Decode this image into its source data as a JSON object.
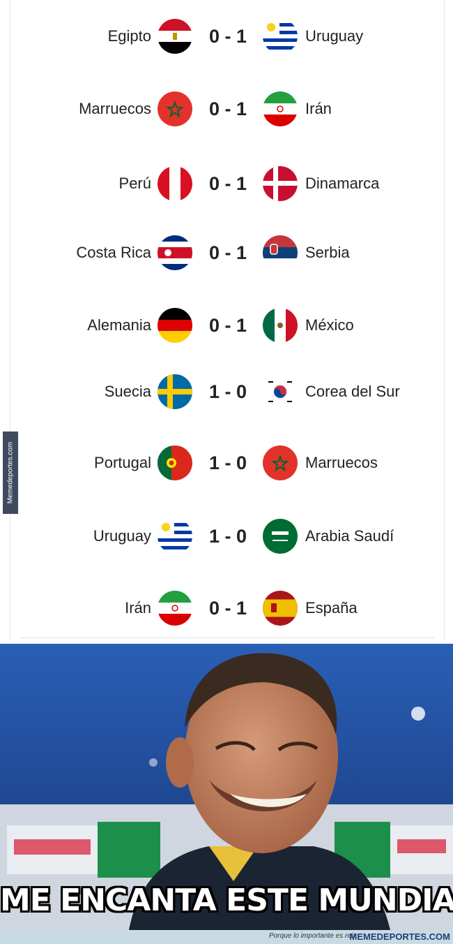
{
  "matches": [
    {
      "home": "Egipto",
      "score": "0 - 1",
      "away": "Uruguay",
      "home_flag": "egypt-flag-icon",
      "away_flag": "uruguay-flag-icon"
    },
    {
      "home": "Marruecos",
      "score": "0 - 1",
      "away": "Irán",
      "home_flag": "morocco-flag-icon",
      "away_flag": "iran-flag-icon"
    },
    {
      "home": "Perú",
      "score": "0 - 1",
      "away": "Dinamarca",
      "home_flag": "peru-flag-icon",
      "away_flag": "denmark-flag-icon"
    },
    {
      "home": "Costa Rica",
      "score": "0 - 1",
      "away": "Serbia",
      "home_flag": "costa-rica-flag-icon",
      "away_flag": "serbia-flag-icon"
    },
    {
      "home": "Alemania",
      "score": "0 - 1",
      "away": "México",
      "home_flag": "germany-flag-icon",
      "away_flag": "mexico-flag-icon"
    },
    {
      "home": "Suecia",
      "score": "1 - 0",
      "away": "Corea del Sur",
      "home_flag": "sweden-flag-icon",
      "away_flag": "south-korea-flag-icon"
    },
    {
      "home": "Portugal",
      "score": "1 - 0",
      "away": "Marruecos",
      "home_flag": "portugal-flag-icon",
      "away_flag": "morocco-flag-icon"
    },
    {
      "home": "Uruguay",
      "score": "1 - 0",
      "away": "Arabia Saudí",
      "home_flag": "uruguay-flag-icon",
      "away_flag": "saudi-arabia-flag-icon"
    },
    {
      "home": "Irán",
      "score": "0 - 1",
      "away": "España",
      "home_flag": "iran-flag-icon",
      "away_flag": "spain-flag-icon"
    }
  ],
  "watermark_side": "Memedeportes.com",
  "meme": {
    "caption": "ME ENCANTA ESTE MUNDIAL",
    "image": "smiling-coach-photo"
  },
  "footer": {
    "tagline": "Porque lo importante es reír",
    "brand": "MEMEDEPORTES.COM"
  }
}
